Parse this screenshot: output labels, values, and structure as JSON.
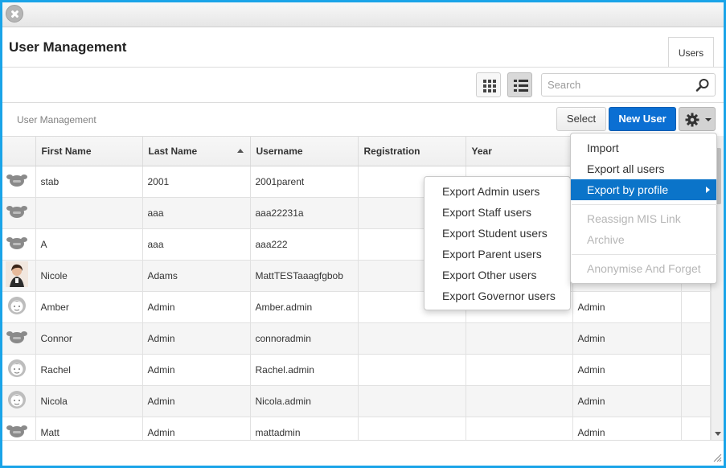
{
  "window": {
    "title": "User Management"
  },
  "tabs": [
    {
      "label": "Users"
    }
  ],
  "toolbar": {
    "search_placeholder": "Search"
  },
  "breadcrumb": "User Management",
  "actions": {
    "select_label": "Select",
    "new_user_label": "New User"
  },
  "table": {
    "columns": [
      "",
      "First Name",
      "Last Name",
      "Username",
      "Registration",
      "Year",
      "",
      ""
    ],
    "sorted_column": "Last Name",
    "sort_direction": "ascending",
    "rows": [
      {
        "avatar": "generic-avatar-icon",
        "first": "stab",
        "last": "2001",
        "username": "2001parent",
        "registration": "",
        "year": "",
        "profile": ""
      },
      {
        "avatar": "generic-avatar-icon",
        "first": "",
        "last": "aaa",
        "username": "aaa22231a",
        "registration": "",
        "year": "",
        "profile": ""
      },
      {
        "avatar": "generic-avatar-icon",
        "first": "A",
        "last": "aaa",
        "username": "aaa222",
        "registration": "",
        "year": "",
        "profile": ""
      },
      {
        "avatar": "photo-avatar",
        "first": "Nicole",
        "last": "Adams",
        "username": "MattTESTaaagfgbob",
        "registration": "",
        "year": "",
        "profile": ""
      },
      {
        "avatar": "female-avatar-icon",
        "first": "Amber",
        "last": "Admin",
        "username": "Amber.admin",
        "registration": "",
        "year": "",
        "profile": "Admin"
      },
      {
        "avatar": "generic-avatar-icon",
        "first": "Connor",
        "last": "Admin",
        "username": "connoradmin",
        "registration": "",
        "year": "",
        "profile": "Admin"
      },
      {
        "avatar": "female-avatar-icon",
        "first": "Rachel",
        "last": "Admin",
        "username": "Rachel.admin",
        "registration": "",
        "year": "",
        "profile": "Admin"
      },
      {
        "avatar": "female-avatar-icon",
        "first": "Nicola",
        "last": "Admin",
        "username": "Nicola.admin",
        "registration": "",
        "year": "",
        "profile": "Admin"
      },
      {
        "avatar": "generic-avatar-icon",
        "first": "Matt",
        "last": "Admin",
        "username": "mattadmin",
        "registration": "",
        "year": "",
        "profile": "Admin"
      }
    ]
  },
  "menu": {
    "items": [
      "Import",
      "Export all users",
      "Export by profile",
      "Reassign MIS Link",
      "Archive",
      "Anonymise And Forget"
    ],
    "active_item": "Export by profile",
    "disabled_items": [
      "Reassign MIS Link",
      "Archive",
      "Anonymise And Forget"
    ]
  },
  "submenu": {
    "items": [
      "Export Admin users",
      "Export Staff users",
      "Export Student users",
      "Export Parent users",
      "Export Other users",
      "Export Governor users"
    ]
  },
  "colors": {
    "frame": "#1aa4e8",
    "primary_button": "#0b6fd3",
    "menu_highlight": "#0b74c9",
    "disabled_text": "#b6b6b6"
  }
}
